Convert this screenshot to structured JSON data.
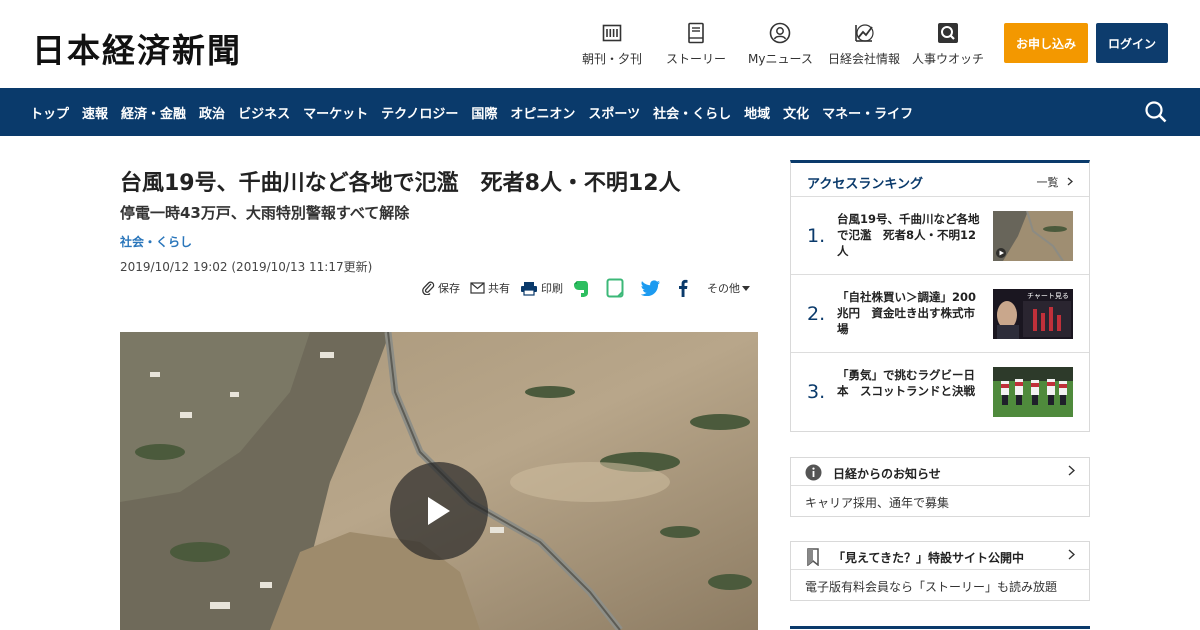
{
  "header": {
    "logo": "日本経済新聞",
    "nav": [
      {
        "label": "朝刊・夕刊",
        "icon": "newspaper-icon"
      },
      {
        "label": "ストーリー",
        "icon": "book-icon"
      },
      {
        "label": "Myニュース",
        "icon": "person-icon"
      },
      {
        "label": "日経会社情報",
        "icon": "chart-icon"
      },
      {
        "label": "人事ウオッチ",
        "icon": "magnifier-icon"
      }
    ],
    "apply_label": "お申し込み",
    "login_label": "ログイン"
  },
  "main_nav": [
    "トップ",
    "速報",
    "経済・金融",
    "政治",
    "ビジネス",
    "マーケット",
    "テクノロジー",
    "国際",
    "オピニオン",
    "スポーツ",
    "社会・くらし",
    "地域",
    "文化",
    "マネー・ライフ"
  ],
  "article": {
    "headline": "台風19号、千曲川など各地で氾濫　死者8人・不明12人",
    "subheadline": "停電一時43万戸、大雨特別警報すべて解除",
    "category": "社会・くらし",
    "timestamp": "2019/10/12 19:02 (2019/10/13 11:17更新)",
    "tools": {
      "save": "保存",
      "share": "共有",
      "print": "印刷",
      "more": "その他"
    }
  },
  "ranking": {
    "title": "アクセスランキング",
    "more": "一覧",
    "items": [
      {
        "rank": "1.",
        "text": "台風19号、千曲川など各地で氾濫　死者8人・不明12人"
      },
      {
        "rank": "2.",
        "text": "「自社株買い＞調達」200兆円　資金吐き出す株式市場"
      },
      {
        "rank": "3.",
        "text": "「勇気」で挑むラグビー日本　スコットランドと決戦"
      }
    ]
  },
  "notice": {
    "title": "日経からのお知らせ",
    "body": "キャリア採用、通年で募集"
  },
  "promo": {
    "title": "「見えてきた？」特設サイト公開中",
    "body": "電子版有料会員なら「ストーリー」も読み放題"
  },
  "thumb_text": {
    "rank2": "チャート見る"
  },
  "colors": {
    "navy": "#0a3a6b",
    "orange": "#f39800",
    "link": "#2a76bb"
  }
}
